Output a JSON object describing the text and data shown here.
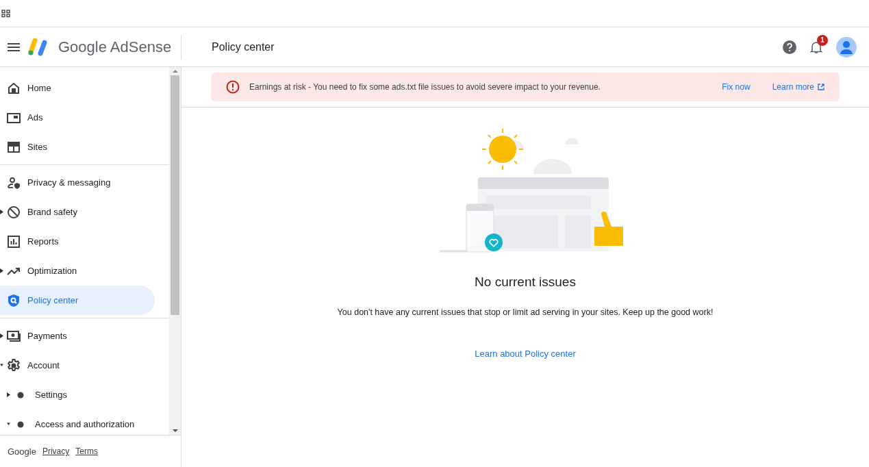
{
  "header": {
    "product": "Google AdSense",
    "page_title": "Policy center",
    "notifications": "1"
  },
  "sidebar": {
    "sections": [
      [
        {
          "label": "Home",
          "selected": false
        },
        {
          "label": "Ads",
          "selected": false
        },
        {
          "label": "Sites",
          "selected": false
        }
      ],
      [
        {
          "label": "Privacy & messaging",
          "selected": false
        },
        {
          "label": "Brand safety",
          "selected": false,
          "expanded": false
        },
        {
          "label": "Reports",
          "selected": false
        },
        {
          "label": "Optimization",
          "selected": false,
          "expanded": false
        },
        {
          "label": "Policy center",
          "selected": true
        }
      ],
      [
        {
          "label": "Payments",
          "selected": false,
          "expanded": false
        },
        {
          "label": "Account",
          "selected": false,
          "expanded": true,
          "children": [
            {
              "label": "Settings",
              "selected": false,
              "expanded": false
            },
            {
              "label": "Access and authorization",
              "selected": false,
              "expanded": true
            }
          ]
        }
      ]
    ],
    "footer": {
      "brand": "Google",
      "links": [
        "Privacy",
        "Terms"
      ]
    }
  },
  "banner": {
    "message": "Earnings at risk - You need to fix some ads.txt file issues to avoid severe impact to your revenue.",
    "actions": [
      "Fix now",
      "Learn more"
    ]
  },
  "empty_state": {
    "title": "No current issues",
    "message": "You don't have any current issues that stop or limit ad serving in your sites. Keep up the good work!",
    "link": "Learn about Policy center"
  }
}
